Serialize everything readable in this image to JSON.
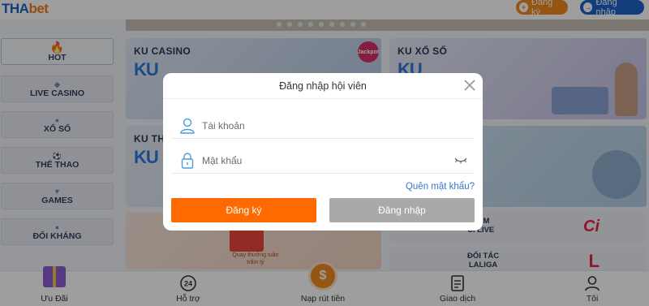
{
  "header": {
    "logo_part1": "THA",
    "logo_part2": "bet",
    "register_label": "Đăng ký",
    "login_label": "Đăng nhập"
  },
  "sidebar": {
    "items": [
      {
        "label": "HOT",
        "icon": "fire-icon"
      },
      {
        "label": "LIVE CASINO",
        "icon": "shield-icon"
      },
      {
        "label": "XỔ SỐ",
        "icon": "lottery-icon"
      },
      {
        "label": "THỂ THAO",
        "icon": "ball-icon"
      },
      {
        "label": "GAMES",
        "icon": "gamepad-icon"
      },
      {
        "label": "ĐỐI KHÁNG",
        "icon": "versus-icon"
      }
    ]
  },
  "cards": {
    "casino_title": "KU CASINO",
    "casino_ku": "KU",
    "jackpot": "Jackpot",
    "xoso_title": "KU XỔ SỐ",
    "xoso_ku": "KU",
    "third_title": "KU TH",
    "third_ku": "KU",
    "promo_text": "Quay thưởng tuần\ntrăm tỷ",
    "ci_title": "RUM\nCI LIVE",
    "ci_logo": "Ci",
    "laliga_title": "ĐỐI TÁC\nLALIGA",
    "laliga_logo": "L"
  },
  "modal": {
    "title": "Đăng nhập hội viên",
    "username_placeholder": "Tài khoản",
    "password_placeholder": "Mật khẩu",
    "forgot_label": "Quên mật khẩu?",
    "register_button": "Đăng ký",
    "login_button": "Đăng nhập"
  },
  "bottom_nav": {
    "items": [
      {
        "label": "Ưu Đãi",
        "icon": "gift-icon"
      },
      {
        "label": "Hỗ trợ",
        "icon": "support-24-icon"
      },
      {
        "label": "Nạp rút tiền",
        "icon": "coin-transfer-icon"
      },
      {
        "label": "Giao dịch",
        "icon": "receipt-icon"
      },
      {
        "label": "Tôi",
        "icon": "user-icon"
      }
    ]
  },
  "colors": {
    "accent_orange": "#ff6a00",
    "brand_blue": "#1e63c8",
    "login_button_gray": "#a9a9a9",
    "link_blue": "#3a78c8"
  }
}
